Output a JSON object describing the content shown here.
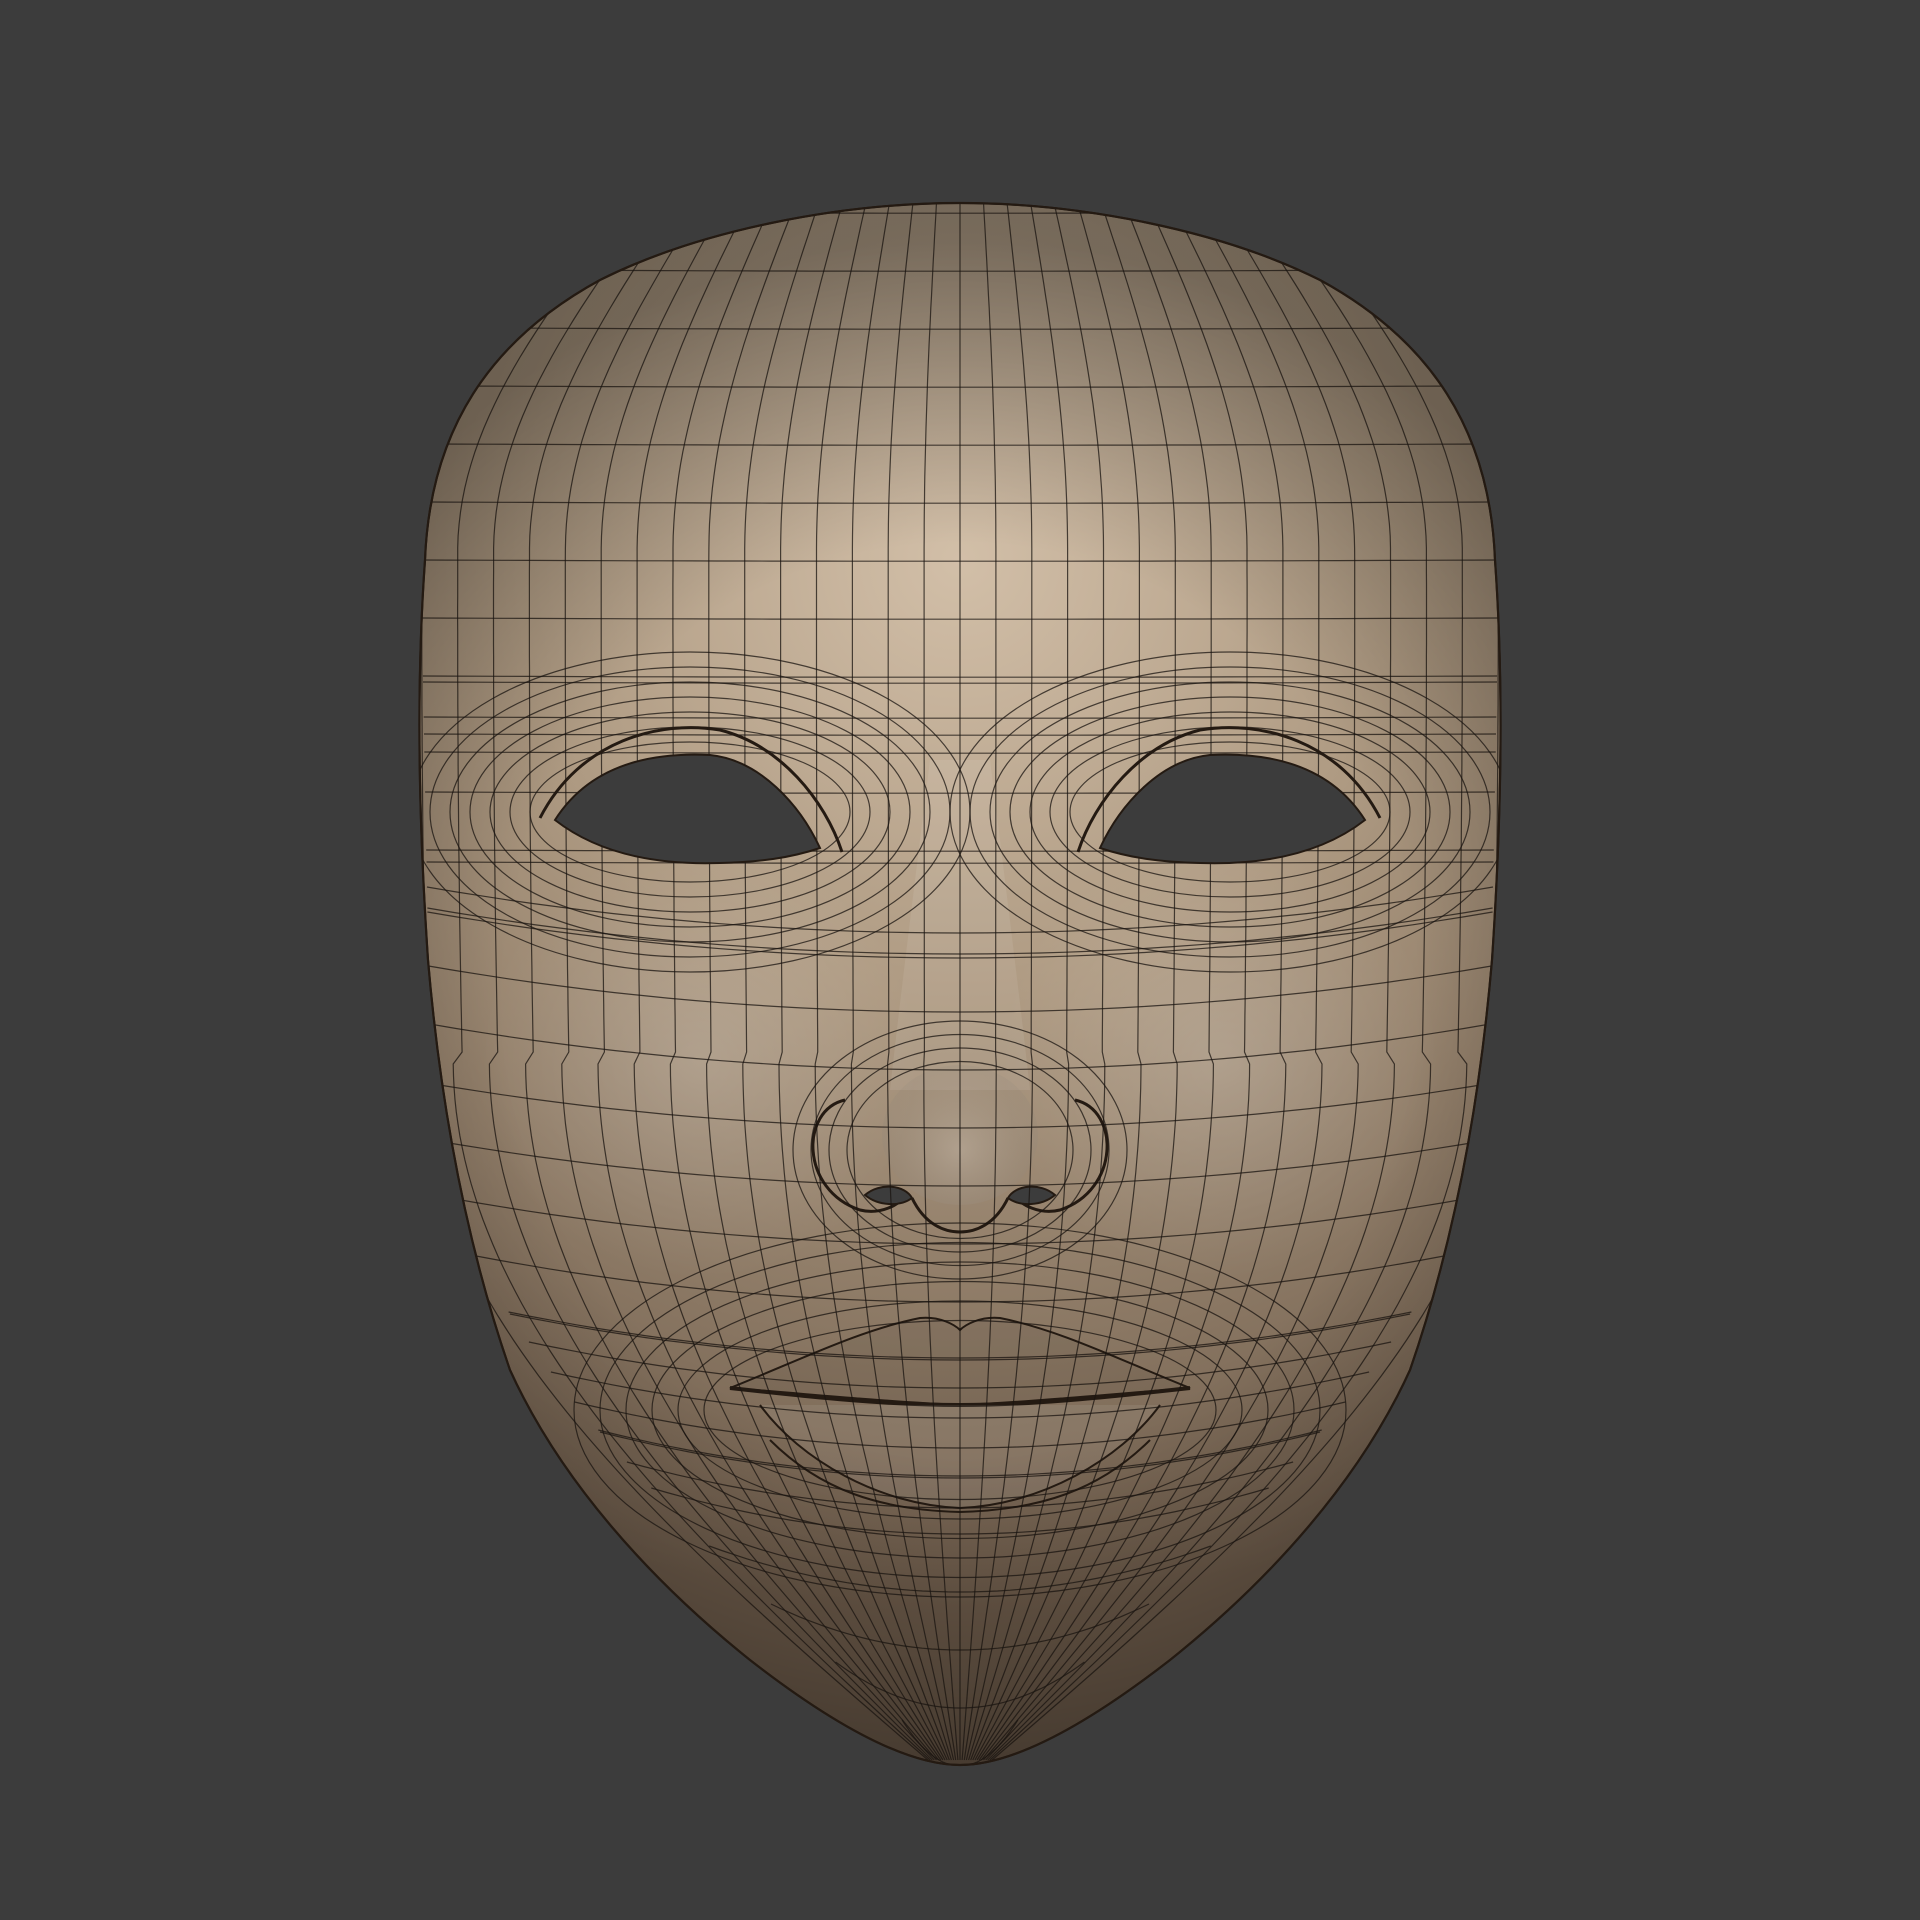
{
  "viewport": {
    "background": "#3c3c3c"
  },
  "model": {
    "kind": "face-mask",
    "topology": "quad-mesh",
    "wireframe_visible": true,
    "eye_openings": 2,
    "colors": {
      "skin_highlight": "#d2bfa8",
      "skin_mid": "#ae9a82",
      "skin_shadow": "#6e5c4b",
      "wire": "#1a1410",
      "eye_hole": "#3c3c3c",
      "outline": "#241a12"
    }
  }
}
